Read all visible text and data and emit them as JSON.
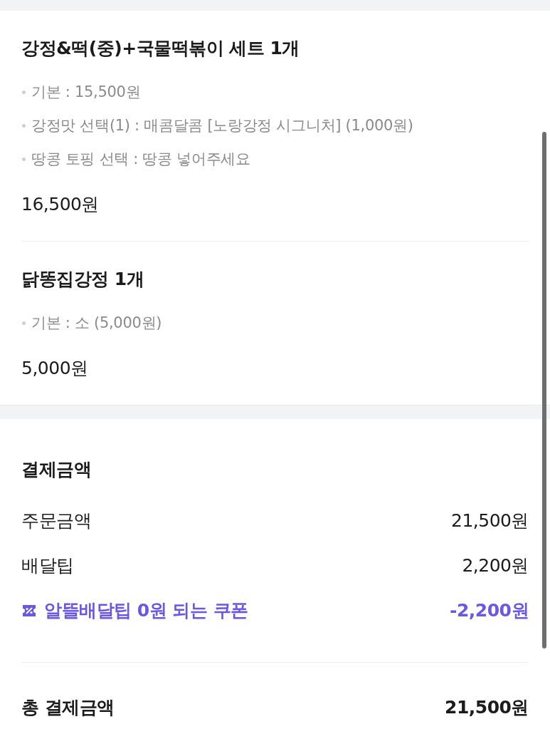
{
  "order_items": [
    {
      "name": "강정&떡(중)+국물떡볶이 세트 1개",
      "options": [
        "기본 : 15,500원",
        "강정맛 선택(1) : 매콤달콤 [노랑강정 시그니처] (1,000원)",
        "땅콩 토핑 선택 : 땅콩 넣어주세요"
      ],
      "price": "16,500원"
    },
    {
      "name": "닭똥집강정 1개",
      "options": [
        "기본 : 소 (5,000원)"
      ],
      "price": "5,000원"
    }
  ],
  "payment": {
    "title": "결제금액",
    "rows": [
      {
        "kind": "plain",
        "label": "주문금액",
        "amount": "21,500원"
      },
      {
        "kind": "plain",
        "label": "배달팁",
        "amount": "2,200원"
      },
      {
        "kind": "coupon",
        "label": "알뜰배달팁 0원 되는 쿠폰",
        "amount": "-2,200원"
      }
    ],
    "total": {
      "label": "총 결제금액",
      "amount": "21,500원"
    }
  }
}
